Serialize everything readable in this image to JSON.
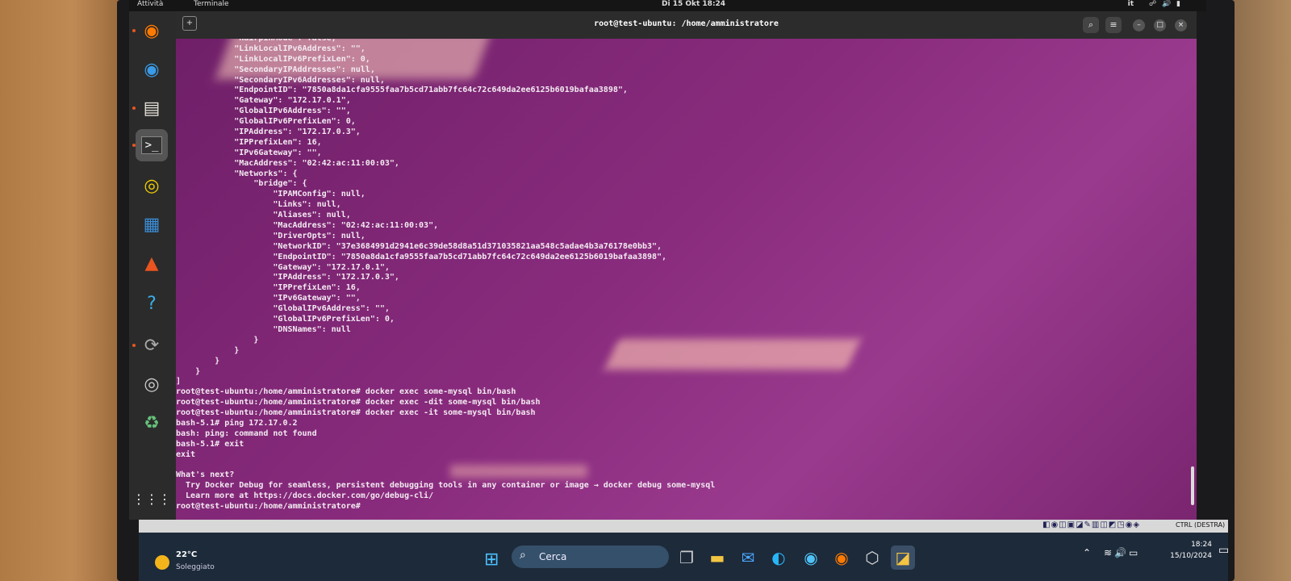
{
  "topbar": {
    "activities": "Attività",
    "app_name": "Terminale",
    "clock": "Di 15 Okt  18:24",
    "lang": "it",
    "tray_icons": [
      "network-icon",
      "volume-icon",
      "battery-icon"
    ]
  },
  "dock": {
    "items": [
      "firefox",
      "thunderbird",
      "files",
      "terminal",
      "rhythmbox",
      "writer",
      "app-center",
      "help",
      "software-updater",
      "dvd",
      "trash",
      "show-apps"
    ]
  },
  "terminal": {
    "title": "root@test-ubuntu: /home/amministratore",
    "lines": [
      "            \"HairpinMode\": false,",
      "            \"LinkLocalIPv6Address\": \"\",",
      "            \"LinkLocalIPv6PrefixLen\": 0,",
      "            \"SecondaryIPAddresses\": null,",
      "            \"SecondaryIPv6Addresses\": null,",
      "            \"EndpointID\": \"7850a8da1cfa9555faa7b5cd71abb7fc64c72c649da2ee6125b6019bafaa3898\",",
      "            \"Gateway\": \"172.17.0.1\",",
      "            \"GlobalIPv6Address\": \"\",",
      "            \"GlobalIPv6PrefixLen\": 0,",
      "            \"IPAddress\": \"172.17.0.3\",",
      "            \"IPPrefixLen\": 16,",
      "            \"IPv6Gateway\": \"\",",
      "            \"MacAddress\": \"02:42:ac:11:00:03\",",
      "            \"Networks\": {",
      "                \"bridge\": {",
      "                    \"IPAMConfig\": null,",
      "                    \"Links\": null,",
      "                    \"Aliases\": null,",
      "                    \"MacAddress\": \"02:42:ac:11:00:03\",",
      "                    \"DriverOpts\": null,",
      "                    \"NetworkID\": \"37e3684991d2941e6c39de58d8a51d371035821aa548c5adae4b3a76178e0bb3\",",
      "                    \"EndpointID\": \"7850a8da1cfa9555faa7b5cd71abb7fc64c72c649da2ee6125b6019bafaa3898\",",
      "                    \"Gateway\": \"172.17.0.1\",",
      "                    \"IPAddress\": \"172.17.0.3\",",
      "                    \"IPPrefixLen\": 16,",
      "                    \"IPv6Gateway\": \"\",",
      "                    \"GlobalIPv6Address\": \"\",",
      "                    \"GlobalIPv6PrefixLen\": 0,",
      "                    \"DNSNames\": null",
      "                }",
      "            }",
      "        }",
      "    }",
      "]",
      "root@test-ubuntu:/home/amministratore# docker exec some-mysql bin/bash",
      "root@test-ubuntu:/home/amministratore# docker exec -dit some-mysql bin/bash",
      "root@test-ubuntu:/home/amministratore# docker exec -it some-mysql bin/bash",
      "bash-5.1# ping 172.17.0.2",
      "bash: ping: command not found",
      "bash-5.1# exit",
      "exit",
      "",
      "What's next?",
      "  Try Docker Debug for seamless, persistent debugging tools in any container or image → docker debug some-mysql",
      "  Learn more at https://docs.docker.com/go/debug-cli/",
      "root@test-ubuntu:/home/amministratore# "
    ]
  },
  "vm_status": {
    "host_key": "CTRL (DESTRA)"
  },
  "taskbar": {
    "temperature": "22°C",
    "weather": "Soleggiato",
    "search_placeholder": "Cerca",
    "time": "18:24",
    "date": "15/10/2024"
  }
}
